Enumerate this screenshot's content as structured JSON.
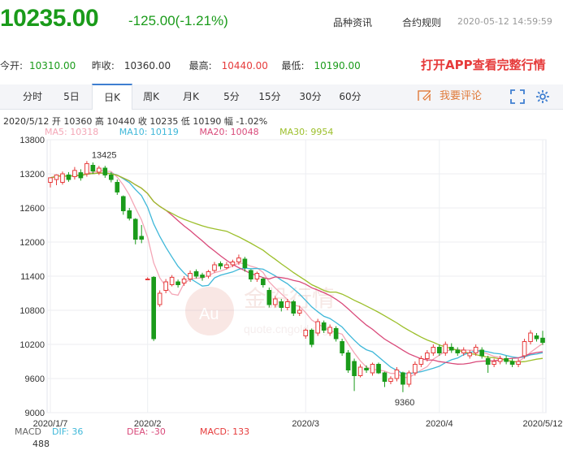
{
  "header": {
    "price": "10235.00",
    "change": "-125.00(-1.21%)",
    "links": [
      "品种资讯",
      "合约规则"
    ],
    "timestamp": "2020-05-12 14:59:59"
  },
  "stats": {
    "open_label": "今开:",
    "open": "10310.00",
    "prev_label": "昨收:",
    "prev": "10360.00",
    "high_label": "最高:",
    "high": "10440.00",
    "low_label": "最低:",
    "low": "10190.00"
  },
  "app_banner": "打开APP查看完整行情",
  "tabs": [
    "分时",
    "5日",
    "日K",
    "周K",
    "月K",
    "5分",
    "15分",
    "30分",
    "60分"
  ],
  "active_tab": "日K",
  "comment_label": "我要评论",
  "info_line": "2020/5/12  开 10360  高 10440  收 10235  低 10190  幅 -1.02%",
  "ma_labels": [
    {
      "text": "MA5: 10318",
      "color": "#f4a6b6"
    },
    {
      "text": "MA10: 10119",
      "color": "#3fb8d9"
    },
    {
      "text": "MA20: 10048",
      "color": "#d94a7a"
    },
    {
      "text": "MA30: 9954",
      "color": "#9cbf2a"
    }
  ],
  "macd": {
    "label": "MACD",
    "dif": "DIF: 36",
    "dea": "DEA: -30",
    "macd": "MACD: 133",
    "axis_value": "488"
  },
  "watermark": {
    "logo": "Au",
    "text": "金投行情",
    "url": "quote.cngold.org"
  },
  "chart_data": {
    "type": "candlestick",
    "ylim": [
      9000,
      13800
    ],
    "yticks": [
      13800,
      13200,
      12600,
      12000,
      11400,
      10800,
      10200,
      9600,
      9000
    ],
    "xtick_labels": [
      "2020/1/7",
      "2020/2",
      "2020/3",
      "2020/4",
      "2020/5/12"
    ],
    "annotations": [
      {
        "text": "13425"
      },
      {
        "text": "9360"
      }
    ],
    "up_color": "#e63b3b",
    "down_color": "#1a9b1a",
    "candles": [
      [
        13050,
        13130,
        13120,
        12960
      ],
      [
        13100,
        13180,
        13190,
        13000
      ],
      [
        13050,
        13200,
        13240,
        13010
      ],
      [
        13180,
        13100,
        13230,
        13060
      ],
      [
        13150,
        13260,
        13320,
        13100
      ],
      [
        13220,
        13130,
        13280,
        13080
      ],
      [
        13200,
        13380,
        13425,
        13150
      ],
      [
        13350,
        13250,
        13400,
        13200
      ],
      [
        13230,
        13300,
        13340,
        13180
      ],
      [
        13300,
        13180,
        13340,
        13130
      ],
      [
        13180,
        13100,
        13230,
        13050
      ],
      [
        13050,
        12880,
        13100,
        12830
      ],
      [
        12800,
        12550,
        12820,
        12480
      ],
      [
        12550,
        12420,
        12600,
        12380
      ],
      [
        12400,
        12050,
        12420,
        11960
      ],
      [
        12100,
        12050,
        12300,
        11980
      ],
      [
        11350,
        11350,
        11380,
        11330
      ],
      [
        11380,
        10300,
        11400,
        10260
      ],
      [
        10900,
        11100,
        11150,
        10860
      ],
      [
        11150,
        11300,
        11350,
        11100
      ],
      [
        11250,
        11380,
        11420,
        11220
      ],
      [
        11300,
        11250,
        11340,
        11200
      ],
      [
        11280,
        11350,
        11400,
        11230
      ],
      [
        11350,
        11450,
        11500,
        11300
      ],
      [
        11480,
        11400,
        11520,
        11360
      ],
      [
        11420,
        11380,
        11460,
        11320
      ],
      [
        11400,
        11480,
        11510,
        11360
      ],
      [
        11500,
        11600,
        11650,
        11460
      ],
      [
        11620,
        11580,
        11660,
        11520
      ],
      [
        11550,
        11600,
        11650,
        11520
      ],
      [
        11600,
        11650,
        11690,
        11560
      ],
      [
        11650,
        11720,
        11780,
        11600
      ],
      [
        11700,
        11550,
        11740,
        11480
      ],
      [
        11500,
        11350,
        11520,
        11300
      ],
      [
        11350,
        11450,
        11480,
        11300
      ],
      [
        11350,
        11250,
        11380,
        11200
      ],
      [
        11150,
        10900,
        11200,
        10850
      ],
      [
        10900,
        11000,
        11050,
        10850
      ],
      [
        10950,
        10850,
        11000,
        10780
      ],
      [
        10850,
        10950,
        11000,
        10800
      ],
      [
        10950,
        10750,
        10980,
        10700
      ],
      [
        10750,
        10800,
        10880,
        10700
      ],
      [
        10350,
        10450,
        10480,
        10300
      ],
      [
        10450,
        10200,
        10480,
        10150
      ],
      [
        10400,
        10600,
        10650,
        10350
      ],
      [
        10580,
        10450,
        10620,
        10400
      ],
      [
        10400,
        10500,
        10550,
        10350
      ],
      [
        10480,
        10300,
        10520,
        10250
      ],
      [
        10250,
        10050,
        10300,
        10000
      ],
      [
        10050,
        9750,
        10100,
        9700
      ],
      [
        9900,
        9650,
        9950,
        9380
      ],
      [
        9650,
        9800,
        9850,
        9620
      ],
      [
        9780,
        9750,
        9830,
        9700
      ],
      [
        9700,
        9850,
        9880,
        9650
      ],
      [
        9850,
        9700,
        9880,
        9680
      ],
      [
        9700,
        9550,
        9720,
        9450
      ],
      [
        9550,
        9600,
        9640,
        9500
      ],
      [
        9600,
        9750,
        9800,
        9550
      ],
      [
        9700,
        9500,
        9720,
        9360
      ],
      [
        9500,
        9700,
        9740,
        9450
      ],
      [
        9700,
        9850,
        9900,
        9650
      ],
      [
        9850,
        9950,
        10000,
        9800
      ],
      [
        9950,
        10050,
        10100,
        9900
      ],
      [
        10050,
        10150,
        10200,
        10000
      ],
      [
        10150,
        10050,
        10200,
        10000
      ],
      [
        10050,
        10200,
        10250,
        10000
      ],
      [
        10150,
        10100,
        10220,
        10050
      ],
      [
        10100,
        10050,
        10150,
        10000
      ],
      [
        10050,
        10100,
        10150,
        10000
      ],
      [
        10000,
        10050,
        10100,
        9950
      ],
      [
        10050,
        10150,
        10200,
        10000
      ],
      [
        10100,
        10000,
        10150,
        9950
      ],
      [
        9950,
        9850,
        10000,
        9700
      ],
      [
        9850,
        9900,
        9950,
        9800
      ],
      [
        9900,
        9950,
        10000,
        9850
      ],
      [
        9950,
        9900,
        10000,
        9850
      ],
      [
        9900,
        9850,
        9950,
        9800
      ],
      [
        9850,
        9900,
        9950,
        9800
      ],
      [
        10000,
        10250,
        10300,
        9950
      ],
      [
        10250,
        10400,
        10450,
        10200
      ],
      [
        10350,
        10300,
        10400,
        10250
      ],
      [
        10310,
        10235,
        10440,
        10190
      ]
    ]
  }
}
